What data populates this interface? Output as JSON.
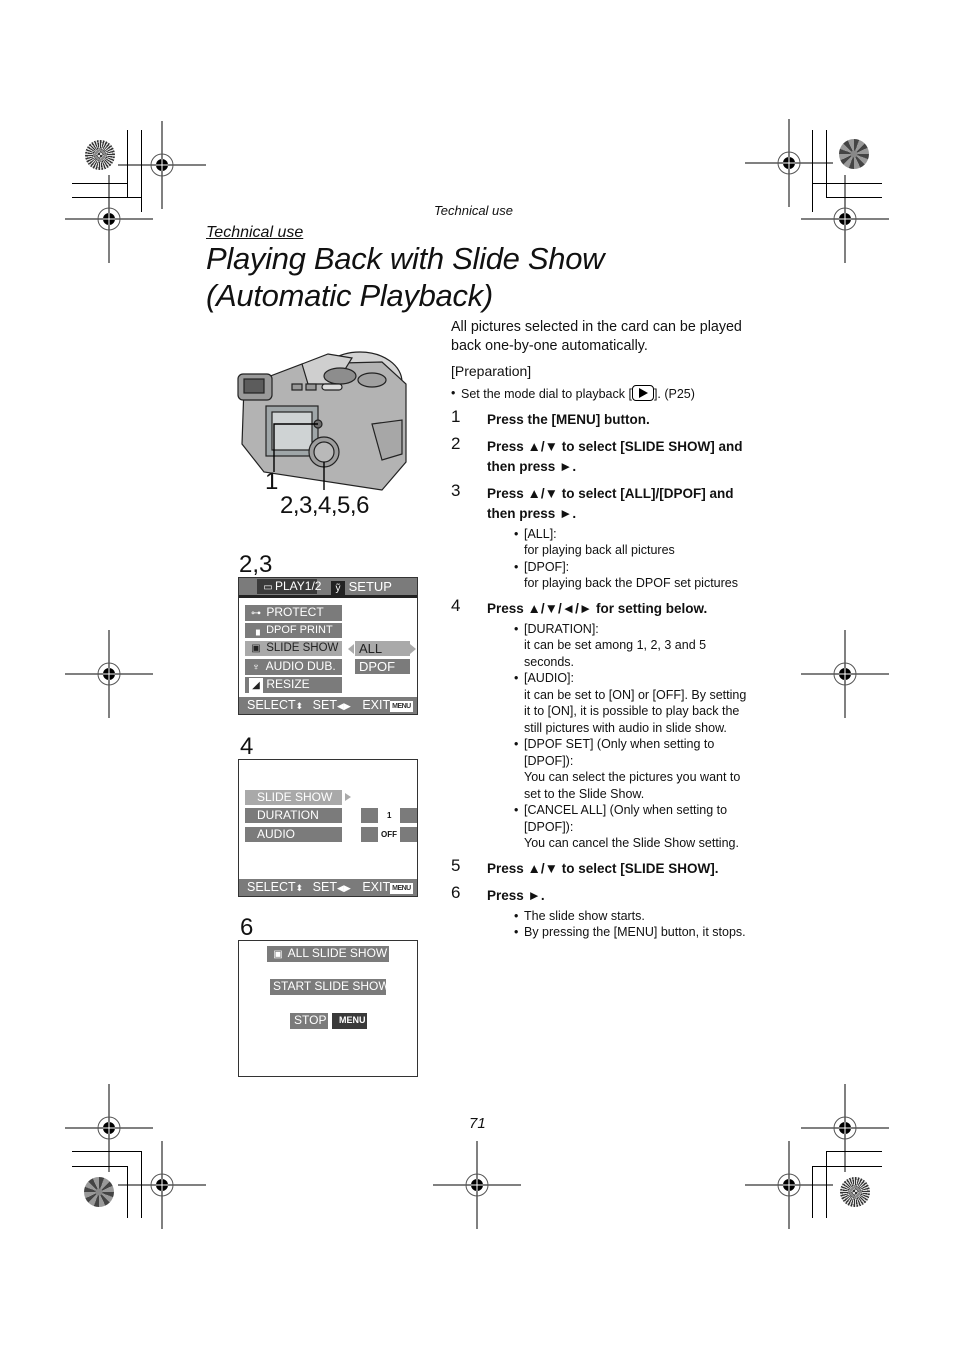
{
  "header": {
    "running_head": "Technical use",
    "section_label": "Technical use",
    "title_line1": "Playing Back with Slide Show",
    "title_line2": "(Automatic Playback)"
  },
  "body": {
    "intro": "All pictures selected in the card can be played back one-by-one automatically.",
    "preparation_label": "[Preparation]",
    "preparation_bullet_pre": "Set the mode dial to playback [",
    "preparation_icon": "playback-icon",
    "preparation_bullet_post": "]. (P25)",
    "steps": [
      {
        "num": "1",
        "text": "Press the [MENU] button.",
        "notes": []
      },
      {
        "num": "2",
        "text": "Press ▲/▼ to select [SLIDE SHOW] and then press ►.",
        "notes": []
      },
      {
        "num": "3",
        "text": "Press ▲/▼ to select [ALL]/[DPOF] and then press ►.",
        "notes": [
          {
            "head": "[ALL]:",
            "body": "for playing back all pictures"
          },
          {
            "head": "[DPOF]:",
            "body": "for playing back the DPOF set pictures"
          }
        ]
      },
      {
        "num": "4",
        "text": "Press ▲/▼/◄/► for setting below.",
        "notes": [
          {
            "head": "[DURATION]:",
            "body": "it can be set among 1, 2, 3 and 5 seconds."
          },
          {
            "head": "[AUDIO]:",
            "body": "it can be set to [ON] or [OFF]. By setting it to [ON], it is possible to play back the still pictures with audio in slide show."
          },
          {
            "head": "[DPOF SET] (Only when setting to [DPOF]):",
            "body": "You can select the pictures you want to set to the Slide Show."
          },
          {
            "head": "[CANCEL ALL] (Only when setting to [DPOF]):",
            "body": "You can cancel the Slide Show setting."
          }
        ]
      },
      {
        "num": "5",
        "text": "Press ▲/▼ to select [SLIDE SHOW].",
        "notes": []
      },
      {
        "num": "6",
        "text": "Press ►.",
        "notes": [
          {
            "head": "The slide show starts.",
            "body": ""
          },
          {
            "head": "By pressing the [MENU] button, it stops.",
            "body": ""
          }
        ]
      }
    ]
  },
  "camera_figure": {
    "label_menu": "1",
    "label_cursor": "2,3,4,5,6"
  },
  "screen_23": {
    "fig_label": "2,3",
    "tab_play": "PLAY1/2",
    "tab_setup": "SETUP",
    "items": [
      "PROTECT",
      "DPOF PRINT",
      "SLIDE SHOW",
      "AUDIO DUB.",
      "RESIZE"
    ],
    "options": [
      "ALL",
      "DPOF"
    ],
    "footer_select": "SELECT",
    "footer_set": "SET",
    "footer_exit": "EXIT",
    "menu_chip": "MENU"
  },
  "screen_4": {
    "fig_label": "4",
    "items": [
      "SLIDE SHOW",
      "DURATION",
      "AUDIO"
    ],
    "duration_value": "1 SEC.",
    "audio_value": "OFF",
    "footer_select": "SELECT",
    "footer_set": "SET",
    "footer_exit": "EXIT",
    "menu_chip": "MENU"
  },
  "screen_6": {
    "fig_label": "6",
    "all_slide_show": "ALL SLIDE SHOW",
    "start_slide_show": "START SLIDE SHOW",
    "stop": "STOP",
    "menu_chip": "MENU"
  },
  "page_number": "71"
}
